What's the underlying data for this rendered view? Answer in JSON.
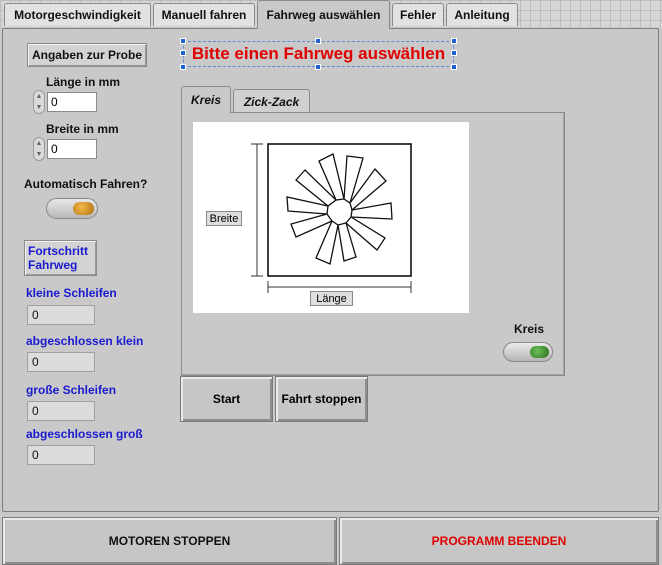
{
  "tabs": [
    "Motorgeschwindigkeit",
    "Manuell fahren",
    "Fahrweg auswählen",
    "Fehler",
    "Anleitung"
  ],
  "active_tab": "Fahrweg auswählen",
  "title_message": "Bitte einen Fahrweg auswählen",
  "left": {
    "probe_button": "Angaben zur Probe",
    "length_label": "Länge in mm",
    "length_value": "0",
    "width_label": "Breite in mm",
    "width_value": "0",
    "auto_label": "Automatisch Fahren?",
    "progress_button": "Fortschritt\nFahrweg",
    "small_loops_label": "kleine Schleifen",
    "small_loops_value": "0",
    "done_small_label": "abgeschlossen klein",
    "done_small_value": "0",
    "big_loops_label": "große Schleifen",
    "big_loops_value": "0",
    "done_big_label": "abgeschlossen groß",
    "done_big_value": "0"
  },
  "path_tabs": [
    "Kreis",
    "Zick-Zack"
  ],
  "diagram": {
    "width_label": "Breite",
    "length_label": "Länge"
  },
  "mode_label": "Kreis",
  "start_button": "Start",
  "stop_drive_button": "Fahrt stoppen",
  "stop_motors_button": "MOTOREN STOPPEN",
  "end_program_button": "PROGRAMM BEENDEN",
  "colors": {
    "accent_red": "#e00000",
    "label_blue": "#1a1ad0",
    "led_orange": "#c98a1a",
    "led_green": "#3a8a2a"
  }
}
